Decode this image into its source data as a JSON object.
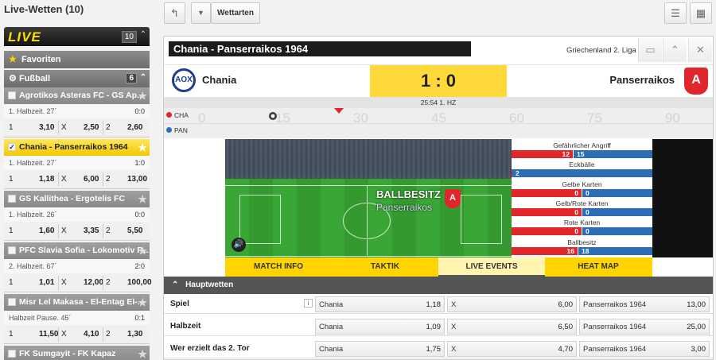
{
  "page_title": "Live-Wetten (10)",
  "live": {
    "logo": "LIVE",
    "count": "10",
    "chevron": "⌃"
  },
  "favorites": {
    "label": "Favoriten"
  },
  "football": {
    "label": "Fußball",
    "count": "6",
    "chevron": "⌃"
  },
  "matches": [
    {
      "teams": "Agrotikos Asteras FC - GS Ap...",
      "status": "1. Halbzeit. 27´",
      "score": "0:0",
      "o1l": "1",
      "o1": "3,10",
      "oxl": "X",
      "ox": "2,50",
      "o2l": "2",
      "o2": "2,60",
      "active": false,
      "checked": false
    },
    {
      "teams": "Chania - Panserraikos 1964",
      "status": "1. Halbzeit. 27´",
      "score": "1:0",
      "o1l": "1",
      "o1": "1,18",
      "oxl": "X",
      "ox": "6,00",
      "o2l": "2",
      "o2": "13,00",
      "active": true,
      "checked": true
    },
    {
      "teams": "GS Kallithea - Ergotelis FC",
      "status": "1. Halbzeit. 26´",
      "score": "0:0",
      "o1l": "1",
      "o1": "1,60",
      "oxl": "X",
      "ox": "3,35",
      "o2l": "2",
      "o2": "5,50",
      "active": false,
      "checked": false
    },
    {
      "teams": "PFC Slavia Sofia - Lokomotiv P...",
      "status": "2. Halbzeit. 67´",
      "score": "2:0",
      "o1l": "1",
      "o1": "1,01",
      "oxl": "X",
      "ox": "12,00",
      "o2l": "2",
      "o2": "100,00",
      "active": false,
      "checked": false
    },
    {
      "teams": "Misr Lel Makasa - El-Entag El-...",
      "status": "Halbzeit Pause. 45´",
      "score": "0:1",
      "o1l": "1",
      "o1": "11,50",
      "oxl": "X",
      "ox": "4,10",
      "o2l": "2",
      "o2": "1,30",
      "active": false,
      "checked": false
    },
    {
      "teams": "FK Sumgayit - FK Kapaz",
      "active": false,
      "checked": false
    }
  ],
  "toolbar": {
    "back_icon": "↰",
    "dropdown_icon": "▼",
    "wettarten": "Wettarten",
    "list_icon": "☰",
    "grid_icon": "▦"
  },
  "panel": {
    "title": "Chania - Panserraikos 1964",
    "league": "Griechenland 2. Liga",
    "screen_icon": "▭",
    "collapse_icon": "⌃",
    "close_icon": "✕",
    "home_team": "Chania",
    "away_team": "Panserraikos",
    "home_crest": "AOX",
    "away_crest": "A",
    "score": "1 : 0",
    "time": "25:54 1. HZ",
    "tl_home": "CHA",
    "tl_away": "PAN",
    "tl_ticks": [
      "0",
      "15",
      "30",
      "45",
      "60",
      "75",
      "90"
    ]
  },
  "field": {
    "ballbesitz": "BALLBESITZ",
    "team": "Panserraikos",
    "crest": "A",
    "sound_icon": "🔊"
  },
  "stats": [
    {
      "label": "Gefährlicher Angriff",
      "home": "12",
      "away": "15",
      "home_share": 0.44
    },
    {
      "label": "Eckbälle",
      "home": "",
      "away": "2",
      "home_share": 0.0
    },
    {
      "label": "Gelbe Karten",
      "home": "0",
      "away": "0",
      "home_share": 0.5
    },
    {
      "label": "Gelb/Rote Karten",
      "home": "0",
      "away": "0",
      "home_share": 0.5
    },
    {
      "label": "Rote Karten",
      "home": "0",
      "away": "0",
      "home_share": 0.5
    },
    {
      "label": "Ballbesitz",
      "home": "16",
      "away": "18",
      "home_share": 0.47
    }
  ],
  "tabs": [
    {
      "label": "MATCH INFO",
      "active": false
    },
    {
      "label": "TAKTIK",
      "active": false
    },
    {
      "label": "LIVE EVENTS",
      "active": true
    },
    {
      "label": "HEAT MAP",
      "active": false
    }
  ],
  "hauptwetten": {
    "label": "Hauptwetten",
    "chevron": "⌃"
  },
  "bets": [
    {
      "name": "Spiel",
      "info": "i",
      "c1": "Chania",
      "o1": "1,18",
      "c2": "X",
      "o2": "6,00",
      "c3": "Panserraikos 1964",
      "o3": "13,00"
    },
    {
      "name": "Halbzeit",
      "c1": "Chania",
      "o1": "1,09",
      "c2": "X",
      "o2": "6,50",
      "c3": "Panserraikos 1964",
      "o3": "25,00"
    },
    {
      "name": "Wer erzielt das 2. Tor",
      "c1": "Chania",
      "o1": "1,75",
      "c2": "X",
      "o2": "4,70",
      "c3": "Panserraikos 1964",
      "o3": "3,00"
    }
  ]
}
